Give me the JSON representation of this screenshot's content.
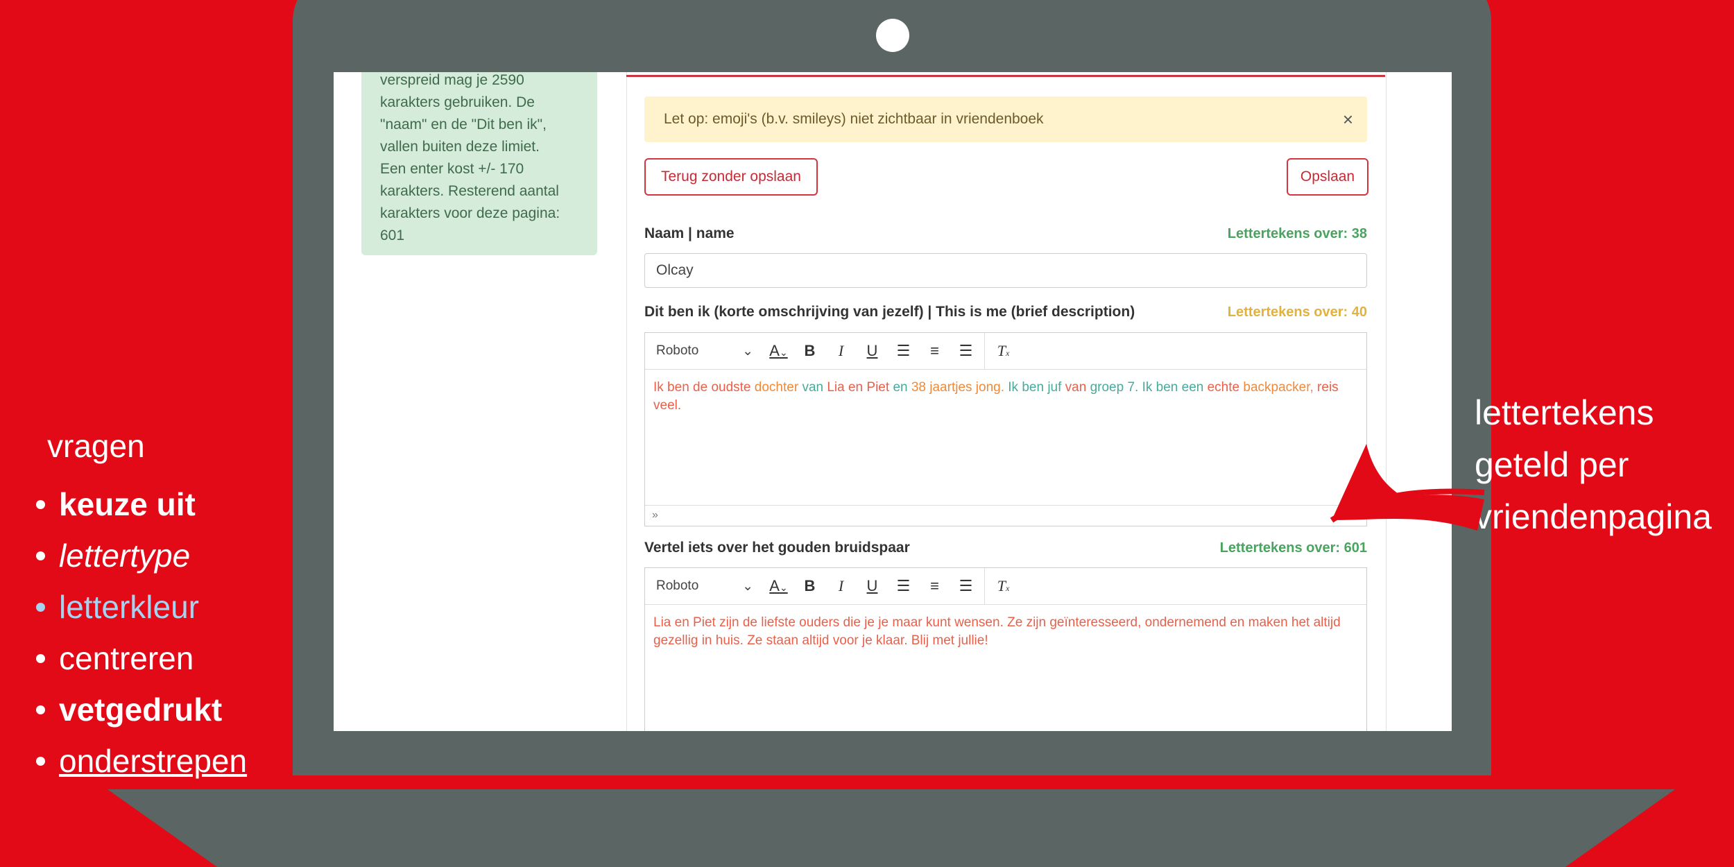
{
  "info_box": {
    "lines": [
      "verspreid mag je 2590",
      "karakters gebruiken. De",
      "\"naam\" en de \"Dit ben ik\",",
      "vallen buiten deze limiet.",
      "Een enter kost +/- 170",
      "karakters. Resterend aantal",
      "karakters voor deze pagina:",
      "601"
    ]
  },
  "alert": {
    "text": "Let op: emoji's (b.v. smileys) niet zichtbaar in vriendenboek",
    "close": "×"
  },
  "buttons": {
    "back": "Terug zonder opslaan",
    "save": "Opslaan"
  },
  "name_field": {
    "label": "Naam | name",
    "counter": "Lettertekens over: 38",
    "value": "Olcay"
  },
  "about_field": {
    "label": "Dit ben ik (korte omschrijving van jezelf) | This is me (brief description)",
    "counter": "Lettertekens over: 40",
    "font": "Roboto",
    "segments": [
      {
        "t": "Ik ben de oudste ",
        "c": "red"
      },
      {
        "t": "dochter ",
        "c": "orange"
      },
      {
        "t": "van ",
        "c": "teal"
      },
      {
        "t": "Lia en Piet ",
        "c": "red"
      },
      {
        "t": "en ",
        "c": "teal"
      },
      {
        "t": "38 jaartjes jong. ",
        "c": "orange"
      },
      {
        "t": "Ik ben juf ",
        "c": "teal"
      },
      {
        "t": "van ",
        "c": "red"
      },
      {
        "t": "groep 7. Ik ben een ",
        "c": "teal"
      },
      {
        "t": "echte ",
        "c": "red"
      },
      {
        "t": "backpacker, ",
        "c": "orange"
      },
      {
        "t": "reis veel.",
        "c": "red"
      }
    ],
    "footer": "»"
  },
  "story_field": {
    "label": "Vertel iets over het gouden bruidspaar",
    "counter": "Lettertekens over: 601",
    "font": "Roboto",
    "text": "Lia en Piet zijn de liefste ouders die je je maar kunt wensen. Ze zijn geïnteresseerd, ondernemend en maken het altijd gezellig in huis. Ze staan altijd voor je klaar. Blij met jullie!"
  },
  "toolbar": {
    "icons": [
      "text-color-icon",
      "bold-icon",
      "italic-icon",
      "underline-icon",
      "align-left-icon",
      "align-center-icon",
      "align-right-icon",
      "clear-format-icon"
    ]
  },
  "left_list": {
    "title": "vragen",
    "items": [
      "keuze uit",
      "lettertype",
      "letterkleur",
      "centreren",
      "vetgedrukt",
      "onderstrepen"
    ]
  },
  "annotation": {
    "lines": [
      "lettertekens",
      "geteld per",
      "vriendenpagina"
    ]
  },
  "colors": {
    "background": "#e20a16",
    "laptop": "#5b6664",
    "accent": "#d2353f",
    "counter_ok": "#4aa35e",
    "counter_warn": "#e3b23c"
  }
}
